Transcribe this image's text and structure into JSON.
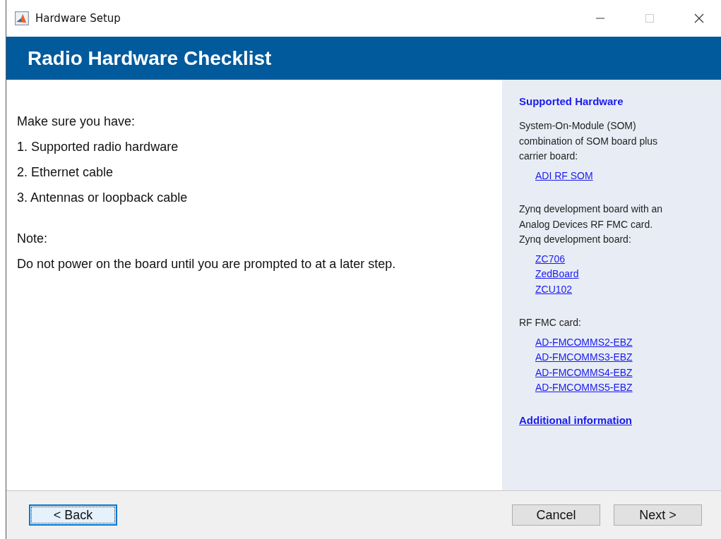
{
  "window": {
    "title": "Hardware Setup",
    "maximize_disabled": true
  },
  "header": {
    "title": "Radio Hardware Checklist"
  },
  "main": {
    "intro": "Make sure you have:",
    "items": [
      "1. Supported radio hardware",
      "2. Ethernet cable",
      "3. Antennas or loopback cable"
    ],
    "note_label": "Note:",
    "note": "Do not power on the board until you are prompted to at a later step."
  },
  "sidebar": {
    "title": "Supported Hardware",
    "groups": [
      {
        "lines": [
          "System-On-Module (SOM)",
          "combination of SOM board plus",
          "carrier board:"
        ],
        "links": [
          "ADI RF SOM"
        ]
      },
      {
        "lines": [
          "Zynq development board with an",
          "Analog Devices RF FMC card.",
          "Zynq development board:"
        ],
        "links": [
          "ZC706",
          "ZedBoard",
          "ZCU102"
        ]
      },
      {
        "lines": [
          "RF FMC card:"
        ],
        "links": [
          "AD-FMCOMMS2-EBZ",
          "AD-FMCOMMS3-EBZ",
          "AD-FMCOMMS4-EBZ",
          "AD-FMCOMMS5-EBZ"
        ]
      }
    ],
    "more_link": "Additional information"
  },
  "buttons": [
    {
      "label": "< Back",
      "focused": true
    },
    {
      "label": "Cancel",
      "focused": false
    },
    {
      "label": "Next >",
      "focused": false
    }
  ]
}
